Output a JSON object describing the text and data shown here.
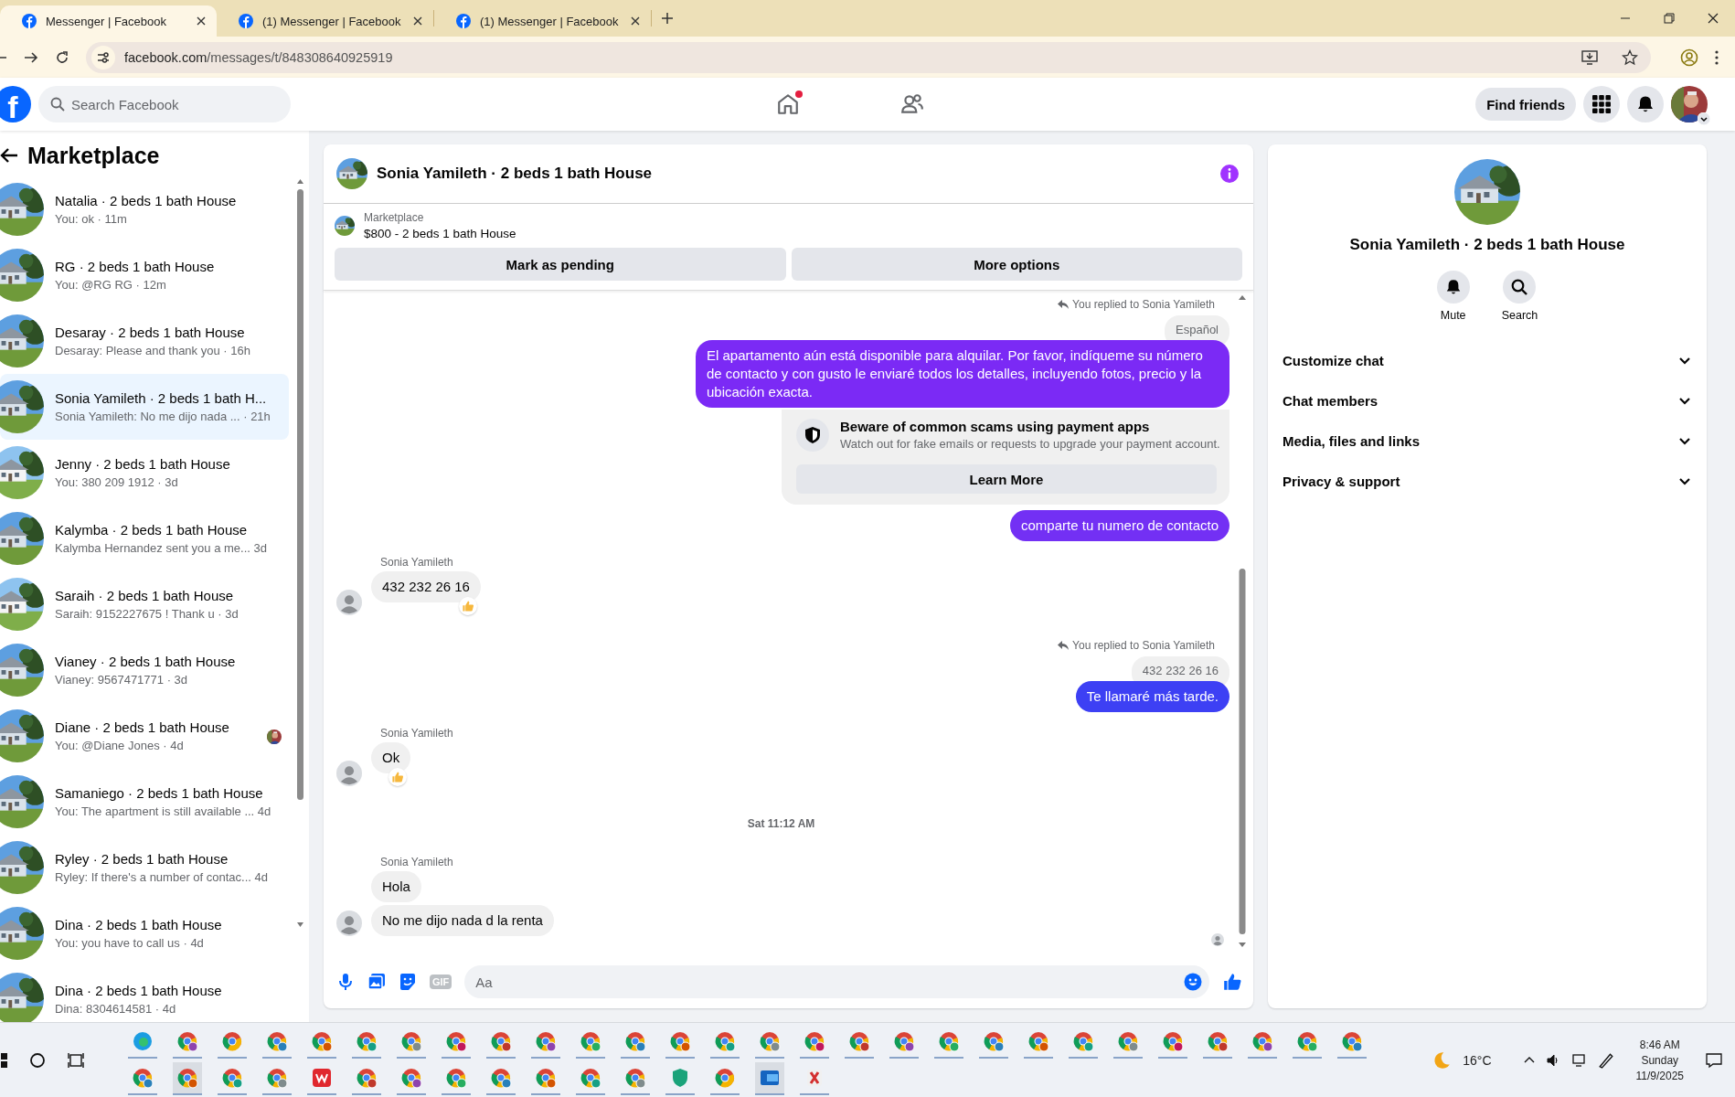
{
  "browser": {
    "tabs": [
      {
        "title": "Messenger | Facebook",
        "selected": true
      },
      {
        "title": "(1) Messenger | Facebook",
        "selected": false
      },
      {
        "title": "(1) Messenger | Facebook",
        "selected": false
      }
    ],
    "url_host": "facebook.com",
    "url_path": "/messages/t/848308640925919"
  },
  "header": {
    "logo": "f",
    "search_placeholder": "Search Facebook",
    "home_badge": true,
    "find_friends": "Find friends"
  },
  "sidebar": {
    "title": "Marketplace",
    "conversations": [
      {
        "name": "Natalia · 2 beds 1 bath House",
        "preview": "You: ok · 11m",
        "selected": false,
        "read_receipt": false
      },
      {
        "name": "RG · 2 beds 1 bath House",
        "preview": "You: @RG RG · 12m",
        "selected": false,
        "read_receipt": false
      },
      {
        "name": "Desaray · 2 beds 1 bath House",
        "preview": "Desaray: Please and thank you · 16h",
        "selected": false,
        "read_receipt": false
      },
      {
        "name": "Sonia Yamileth · 2 beds 1 bath H...",
        "preview": "Sonia Yamileth: No me dijo nada ...  · 21h",
        "selected": true,
        "read_receipt": false
      },
      {
        "name": "Jenny · 2 beds 1 bath House",
        "preview": "You: 380 209 1912 · 3d",
        "selected": false,
        "read_receipt": false
      },
      {
        "name": "Kalymba · 2 beds 1 bath House",
        "preview": "Kalymba Hernandez sent you a me...  3d",
        "selected": false,
        "read_receipt": false
      },
      {
        "name": "Saraih · 2 beds 1 bath House",
        "preview": "Saraih: 9152227675 ! Thank u · 3d",
        "selected": false,
        "read_receipt": false
      },
      {
        "name": "Vianey · 2 beds 1 bath House",
        "preview": "Vianey: 9567471771 · 3d",
        "selected": false,
        "read_receipt": false
      },
      {
        "name": "Diane · 2 beds 1 bath House",
        "preview": "You: @Diane Jones · 4d",
        "selected": false,
        "read_receipt": true
      },
      {
        "name": "Samaniego · 2 beds 1 bath House",
        "preview": "You: The apartment is still available ... 4d",
        "selected": false,
        "read_receipt": false
      },
      {
        "name": "Ryley · 2 beds 1 bath House",
        "preview": "Ryley: If there's a number of contac...  4d",
        "selected": false,
        "read_receipt": false
      },
      {
        "name": "Dina · 2 beds 1 bath House",
        "preview": "You: you have to call us · 4d",
        "selected": false,
        "read_receipt": false
      },
      {
        "name": "Dina · 2 beds 1 bath House",
        "preview": "Dina: 8304614581 · 4d",
        "selected": false,
        "read_receipt": false
      }
    ]
  },
  "chat": {
    "title": "Sonia Yamileth · 2 beds 1 bath House",
    "listing": {
      "label": "Marketplace",
      "title": "$800 - 2 beds 1 bath House"
    },
    "buttons": [
      "Mark as pending",
      "More options"
    ],
    "messages": [
      {
        "kind": "reply_note",
        "text": "You replied to Sonia Yamileth"
      },
      {
        "kind": "quoted",
        "text": "Español"
      },
      {
        "kind": "outgoing",
        "text": "El apartamento aún está disponible para alquilar. Por favor, indíqueme su número de contacto y con gusto le enviaré todos los detalles, incluyendo fotos, precio y la ubicación exacta.",
        "color": "#7b2af5"
      },
      {
        "kind": "notice",
        "title": "Beware of common scams using payment apps",
        "text": "Watch out for fake emails or requests to upgrade your payment account.",
        "button": "Learn More"
      },
      {
        "kind": "outgoing",
        "text": "comparte tu numero de contacto",
        "color": "#7330f4"
      },
      {
        "kind": "sender",
        "text": "Sonia Yamileth"
      },
      {
        "kind": "incoming",
        "text": "432 232 26 16",
        "reaction": true,
        "avatar": true
      },
      {
        "kind": "reply_note",
        "text": "You replied to Sonia Yamileth"
      },
      {
        "kind": "quoted",
        "text": "432 232 26 16"
      },
      {
        "kind": "outgoing",
        "text": "Te llamaré más tarde.",
        "color": "#3d40f4"
      },
      {
        "kind": "sender",
        "text": "Sonia Yamileth"
      },
      {
        "kind": "incoming",
        "text": "Ok",
        "reaction": true,
        "avatar": true
      },
      {
        "kind": "timestamp",
        "text": "Sat 11:12 AM"
      },
      {
        "kind": "sender",
        "text": "Sonia Yamileth"
      },
      {
        "kind": "incoming",
        "text": "Hola",
        "reaction": false,
        "avatar": false
      },
      {
        "kind": "incoming",
        "text": "No me dijo nada d la renta",
        "reaction": false,
        "avatar": true
      }
    ],
    "seen_indicator": true,
    "composer": {
      "placeholder": "Aa",
      "gif_label": "GIF"
    }
  },
  "details": {
    "name": "Sonia Yamileth · 2 beds 1 bath House",
    "actions": [
      {
        "kind": "mute",
        "label": "Mute"
      },
      {
        "kind": "search",
        "label": "Search"
      }
    ],
    "sections": [
      {
        "label": "Customize chat",
        "expanded": false
      },
      {
        "label": "Chat members",
        "expanded": false
      },
      {
        "label": "Media, files and links",
        "expanded": false
      },
      {
        "label": "Privacy & support",
        "expanded": false
      }
    ]
  },
  "taskbar": {
    "weather": "16°C",
    "time": "8:46 AM",
    "day": "Sunday",
    "date": "11/9/2025"
  }
}
